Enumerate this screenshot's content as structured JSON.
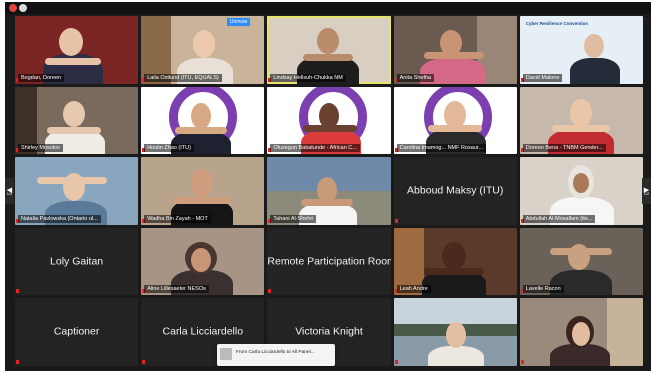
{
  "tiles": [
    {
      "name": "Bogdan, Doreen",
      "bg": "#8a2a2a"
    },
    {
      "name": "Laila Ostlund (ITU, EQUALS)",
      "bg": "#c9b39a",
      "badge": "Unmute"
    },
    {
      "name": "Lindsay Hellsuh-Chukka NM",
      "bg": "#d8cfc2",
      "speaking": true
    },
    {
      "name": "Anita Shetha",
      "bg": "#6a5a50"
    },
    {
      "name": "David Malone",
      "bg": "#e6eef6",
      "slide": "Cyber Resilience Convention"
    },
    {
      "name": "Shirley Mosolos",
      "bg": "#7a6a5e"
    },
    {
      "name": "Houlin Zhao (ITU)",
      "bg": "#ffffff",
      "logo": true
    },
    {
      "name": "Olusegun Babatunde - African C...",
      "bg": "#ffffff",
      "logo": true
    },
    {
      "name": "Carolina Imamog... NMF Rosaur...",
      "bg": "#ffffff",
      "logo": true
    },
    {
      "name": "Doreen Bena - TNBM Gender...",
      "bg": "#c7b8ac"
    },
    {
      "name": "Natalia Pavlowska (Ontario ul...",
      "bg": "#8aa6bf"
    },
    {
      "name": "Wadha Bin Zayah - MOT",
      "bg": "#b8a48c"
    },
    {
      "name": "Tahani Al-Shehri",
      "bg": "#6f8aa8"
    },
    {
      "name": "Abboud Maksy (ITU)",
      "bg": "#252525",
      "text_only": true
    },
    {
      "name": "Abdullah Al-Mosallam (ite...",
      "bg": "#d9d2c8"
    },
    {
      "name": "Loly Gaitan",
      "bg": "#252525",
      "text_only": true
    },
    {
      "name": "Aline Lillesaeter NESOs",
      "bg": "#a89484"
    },
    {
      "name": "Remote Participation Room L",
      "bg": "#252525",
      "text_only": true
    },
    {
      "name": "Leah Andre",
      "bg": "#5a3a2a"
    },
    {
      "name": "Lavelle Racon",
      "bg": "#6a6158"
    },
    {
      "name": "Captioner",
      "bg": "#252525",
      "text_only": true
    },
    {
      "name": "Carla Licciardello",
      "bg": "#252525",
      "text_only": true
    },
    {
      "name": "Victoria Knight",
      "bg": "#252525",
      "text_only": true
    },
    {
      "name": "",
      "bg": "#8a9ba8"
    },
    {
      "name": "",
      "bg": "#9a8a7c"
    }
  ],
  "page_left": "1/2",
  "page_right": "1/2",
  "toast": "From Carla Licciardello to All Panel..."
}
